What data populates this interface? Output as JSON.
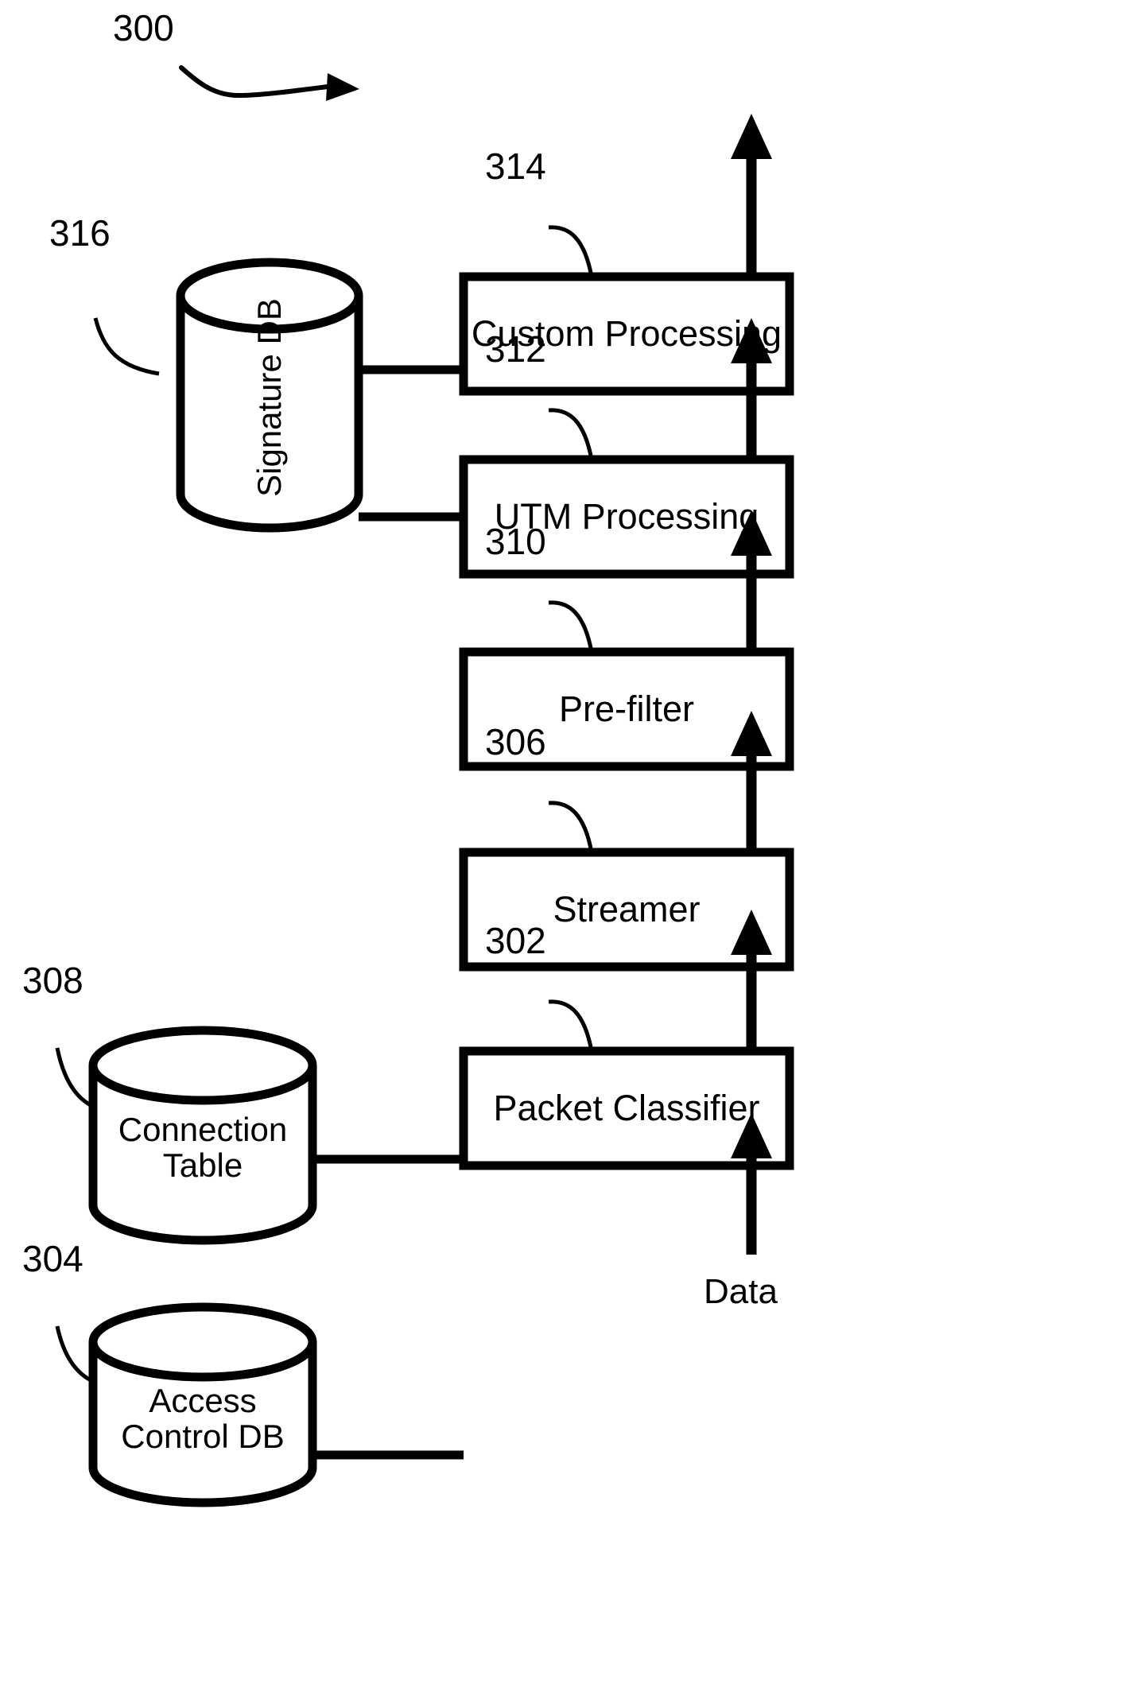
{
  "figure": {
    "number": "300",
    "type": "patent-block-diagram",
    "background": "#ffffff",
    "line_color": "#000000"
  },
  "blocks": [
    {
      "id": "314",
      "label": "Custom Processing",
      "ref": "314"
    },
    {
      "id": "312",
      "label": "UTM Processing",
      "ref": "312"
    },
    {
      "id": "310",
      "label": "Pre-filter",
      "ref": "310"
    },
    {
      "id": "306",
      "label": "Streamer",
      "ref": "306"
    },
    {
      "id": "302",
      "label": "Packet Classifier",
      "ref": "302"
    }
  ],
  "datastores": [
    {
      "id": "316",
      "label": "Signature DB",
      "ref": "316",
      "orientation": "vertical"
    },
    {
      "id": "308",
      "label_line1": "Connection",
      "label_line2": "Table",
      "ref": "308",
      "orientation": "horizontal"
    },
    {
      "id": "304",
      "label_line1": "Access",
      "label_line2": "Control DB",
      "ref": "304",
      "orientation": "horizontal"
    }
  ],
  "refs": {
    "r300": "300",
    "r314": "314",
    "r316": "316",
    "r312": "312",
    "r310": "310",
    "r308": "308",
    "r306": "306",
    "r304": "304",
    "r302": "302"
  },
  "io": {
    "input_label": "Data"
  }
}
